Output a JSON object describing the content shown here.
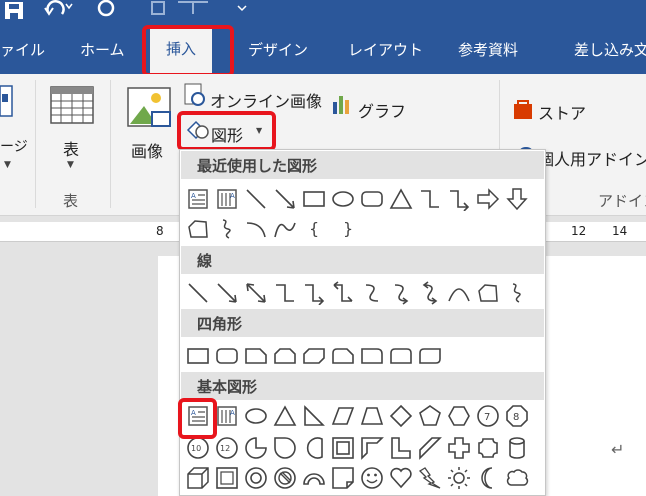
{
  "ribbon_tabs": {
    "file": "ァイル",
    "home": "ホーム",
    "insert": "挿入",
    "design": "デザイン",
    "layout": "レイアウト",
    "references": "参考資料",
    "mailings": "差し込み文"
  },
  "ribbon": {
    "cover_page": "ージ",
    "table": "表",
    "table_group": "表",
    "pictures": "画像",
    "online_pictures": "オンライン画像",
    "shapes": "図形",
    "chart": "グラフ",
    "store": "ストア",
    "my_addins": "個人用アドイン",
    "addins_group": "アドイン"
  },
  "ruler": {
    "labels": [
      "8",
      "12",
      "14"
    ]
  },
  "shapes_menu": {
    "recent": "最近使用した図形",
    "lines": "線",
    "rectangles": "四角形",
    "basic": "基本図形"
  },
  "paragraph_mark": "↵",
  "colors": {
    "accent": "#2b579a",
    "highlight": "#e8151d"
  }
}
